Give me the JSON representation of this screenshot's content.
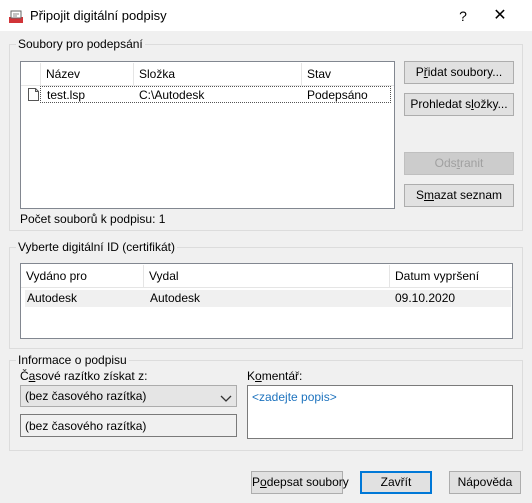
{
  "window": {
    "title": "Připojit digitální podpisy",
    "help_label": "?",
    "close_label": "✕"
  },
  "files_group": {
    "title": "Soubory pro podepsání",
    "columns": [
      "Název",
      "Složka",
      "Stav"
    ],
    "rows": [
      {
        "name": "test.lsp",
        "folder": "C:\\Autodesk",
        "status": "Podepsáno"
      }
    ],
    "count_label": "Počet souborů k podpisu: 1",
    "buttons": {
      "add_files_pre": "P",
      "add_files_u": "ř",
      "add_files_post": "idat soubory...",
      "search_folders_pre": "Prohledat s",
      "search_folders_u": "l",
      "search_folders_post": "ožky...",
      "remove_pre": "Ods",
      "remove_u": "t",
      "remove_post": "ranit",
      "clear_list_pre": "S",
      "clear_list_u": "m",
      "clear_list_post": "azat seznam"
    }
  },
  "id_group": {
    "title": "Vyberte digitální ID (certifikát)",
    "columns": [
      "Vydáno pro",
      "Vydal",
      "Datum vypršení"
    ],
    "rows": [
      {
        "issued_to": "Autodesk",
        "issued_by": "Autodesk",
        "expires": "09.10.2020"
      }
    ]
  },
  "info_group": {
    "title": "Informace o podpisu",
    "timestamp_label_pre": "Č",
    "timestamp_label_u": "a",
    "timestamp_label_post": "sové razítko získat z:",
    "timestamp_select_value": "(bez časového razítka)",
    "timestamp_readonly_value": "(bez časového razítka)",
    "comment_label_pre": "K",
    "comment_label_u": "o",
    "comment_label_post": "mentář:",
    "comment_placeholder": "<zadejte popis>"
  },
  "footer": {
    "sign_pre": "P",
    "sign_u": "o",
    "sign_post": "depsat soubory",
    "close_label": "Zavřít",
    "help_label": "Nápověda"
  },
  "colors": {
    "accent": "#0078d7",
    "placeholder": "#1e73be",
    "row_highlight": "#f0f0f0"
  }
}
